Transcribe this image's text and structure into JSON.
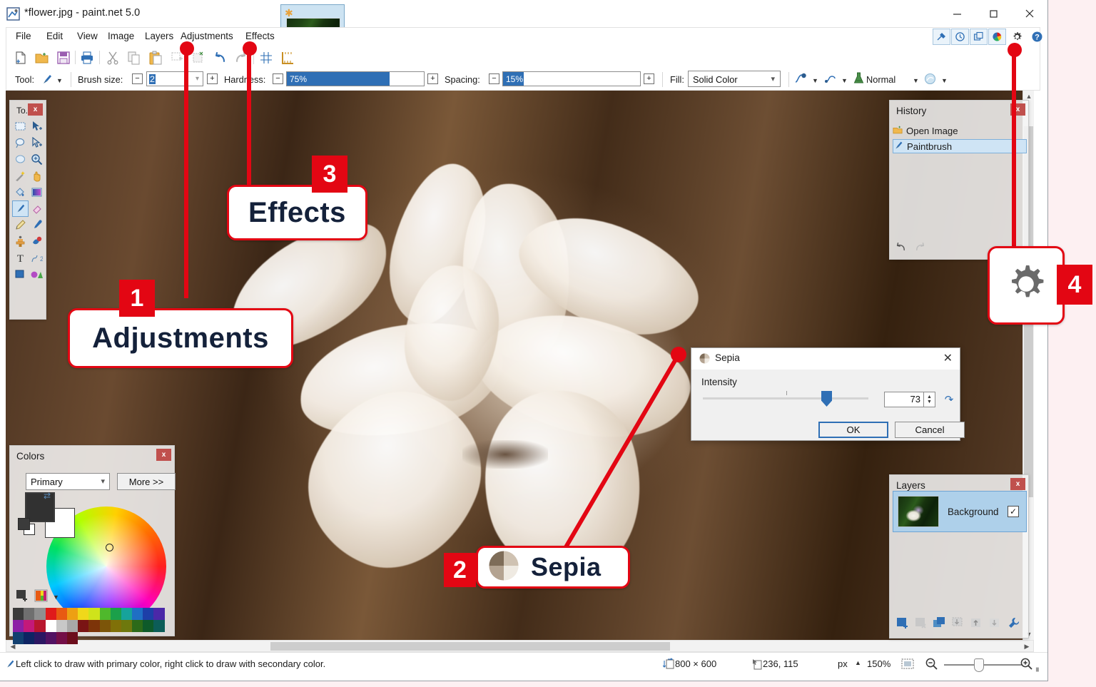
{
  "window": {
    "title": "*flower.jpg - paint.net 5.0",
    "icon": "paintnet-app-icon",
    "minimize": "minimize-icon",
    "maximize": "maximize-icon",
    "close": "close-icon"
  },
  "menu": {
    "items": [
      "File",
      "Edit",
      "View",
      "Image",
      "Layers",
      "Adjustments",
      "Effects"
    ],
    "help_icon": "help-icon"
  },
  "top_right_toolbar": {
    "buttons": [
      "tools-icon",
      "history-icon",
      "layers-icon",
      "colors-icon"
    ],
    "settings": "gear-icon",
    "help": "help-icon"
  },
  "document_tab": {
    "unsaved_marker": "unsaved-star-icon",
    "thumbnail": "flower-thumbnail",
    "overflow": "chevron-down-icon"
  },
  "icon_toolbar": {
    "icons": [
      "new-icon",
      "open-icon",
      "save-icon",
      "print-icon",
      "cut-icon",
      "copy-icon",
      "paste-icon",
      "crop-to-selection-icon",
      "deselect-icon",
      "undo-icon",
      "redo-icon",
      "grid-icon",
      "rulers-icon"
    ]
  },
  "tool_options": {
    "tool_label": "Tool:",
    "tool_icon": "paintbrush-icon",
    "brush_size_label": "Brush size:",
    "brush_size_value": "2",
    "hardness_label": "Hardness:",
    "hardness_value": "75%",
    "hardness_percent": 75,
    "spacing_label": "Spacing:",
    "spacing_value": "15%",
    "spacing_percent": 15,
    "fill_label": "Fill:",
    "fill_value": "Solid Color",
    "antialiasing_icon": "antialiasing-icon",
    "blending_icon": "blending-icon",
    "blend_mode_icon": "flask-icon",
    "blend_mode_value": "Normal",
    "alpha_icon": "alpha-blending-icon",
    "minus_label": "⊖",
    "plus_label": "⊕"
  },
  "tools_panel": {
    "title": "To...",
    "close": "close-icon",
    "tools": [
      {
        "name": "rectangle-select-tool",
        "glyph": "rect-select"
      },
      {
        "name": "move-selected-tool",
        "glyph": "move-selected"
      },
      {
        "name": "lasso-select-tool",
        "glyph": "lasso"
      },
      {
        "name": "move-selection-tool",
        "glyph": "move-selection"
      },
      {
        "name": "ellipse-select-tool",
        "glyph": "ellipse-select"
      },
      {
        "name": "zoom-tool",
        "glyph": "magnifier"
      },
      {
        "name": "magic-wand-tool",
        "glyph": "wand"
      },
      {
        "name": "pan-tool",
        "glyph": "hand"
      },
      {
        "name": "paint-bucket-tool",
        "glyph": "bucket"
      },
      {
        "name": "gradient-tool",
        "glyph": "gradient"
      },
      {
        "name": "paintbrush-tool",
        "glyph": "brush",
        "selected": true
      },
      {
        "name": "eraser-tool",
        "glyph": "eraser"
      },
      {
        "name": "pencil-tool",
        "glyph": "pencil"
      },
      {
        "name": "color-picker-tool",
        "glyph": "dropper"
      },
      {
        "name": "clone-stamp-tool",
        "glyph": "stamp"
      },
      {
        "name": "recolor-tool",
        "glyph": "recolor"
      },
      {
        "name": "text-tool",
        "glyph": "text"
      },
      {
        "name": "line-curve-tool",
        "glyph": "line-curve"
      },
      {
        "name": "shapes-tool",
        "glyph": "shapes"
      },
      {
        "name": "shapes-extra-tool",
        "glyph": "shapes-extra"
      }
    ]
  },
  "history_panel": {
    "title": "History",
    "close": "close-icon",
    "items": [
      {
        "label": "Open Image",
        "icon": "open-image-icon",
        "selected": false
      },
      {
        "label": "Paintbrush",
        "icon": "paintbrush-icon",
        "selected": true
      }
    ],
    "undo_icon": "undo-icon",
    "redo_icon": "redo-icon"
  },
  "layers_panel": {
    "title": "Layers",
    "close": "close-icon",
    "layers": [
      {
        "name": "Background",
        "visible": true,
        "checkmark": "✓"
      }
    ],
    "buttons": [
      "add-layer-icon",
      "delete-layer-icon",
      "duplicate-layer-icon",
      "merge-layer-down-icon",
      "move-layer-up-icon",
      "move-layer-down-icon",
      "layer-properties-icon"
    ]
  },
  "colors_panel": {
    "title": "Colors",
    "close": "close-icon",
    "mode_value": "Primary",
    "more_label": "More >>",
    "swap_icon": "swap-colors-icon",
    "primary_color": "#313131",
    "secondary_color": "#ffffff",
    "add_swatch_icon": "add-swatch-icon",
    "palette_icon": "palette-icon",
    "palette_row_1": [
      "#3b3b3b",
      "#6f6f6f",
      "#8f8f8f",
      "#e01b1b",
      "#e85a12",
      "#eda013",
      "#f0d81a",
      "#cfe31b",
      "#4fb82c",
      "#1ba04a",
      "#16a39b",
      "#1f6fc4",
      "#1d3fa8",
      "#4b28a8",
      "#8d1fa6",
      "#c4197a",
      "#b8162f"
    ],
    "palette_row_2": [
      "#ffffff",
      "#c8c8c8",
      "#a8a8a8",
      "#7a1414",
      "#7d3409",
      "#7c5509",
      "#807008",
      "#6e780d",
      "#2c6a19",
      "#0e5a2a",
      "#0c5d58",
      "#124070",
      "#0e2463",
      "#2c1763",
      "#521263",
      "#730e47",
      "#6c0d1c"
    ]
  },
  "canvas": {
    "image_description": "sepia-toned-flower-photo"
  },
  "sepia_dialog": {
    "title": "Sepia",
    "icon": "sepia-effect-icon",
    "close": "close-icon",
    "intensity_label": "Intensity",
    "intensity_value": "73",
    "intensity_percent": 73,
    "reset_icon": "reset-icon",
    "spinner_up": "▲",
    "spinner_down": "▼",
    "ok_label": "OK",
    "cancel_label": "Cancel"
  },
  "status_bar": {
    "hint_icon": "paintbrush-icon",
    "hint": "Left click to draw with primary color, right click to draw with secondary color.",
    "size_icon": "image-size-icon",
    "size": "800 × 600",
    "cursor_icon": "cursor-position-icon",
    "cursor": "236, 115",
    "units": "px",
    "units_caret": "▲",
    "zoom": "150%",
    "fit_icon": "fit-to-window-icon",
    "zoom_out_icon": "zoom-out-icon",
    "zoom_in_icon": "zoom-in-icon",
    "resize_grip": "resize-grip-icon"
  },
  "annotations": {
    "accent": "#e30613",
    "items": [
      {
        "number": "1",
        "label": "Adjustments",
        "target": "menu-item-adjustments"
      },
      {
        "number": "2",
        "label": "Sepia",
        "target": "sepia-menu-entry"
      },
      {
        "number": "3",
        "label": "Effects",
        "target": "menu-item-effects"
      },
      {
        "number": "4",
        "label": "",
        "target": "settings-gear-button"
      }
    ]
  }
}
